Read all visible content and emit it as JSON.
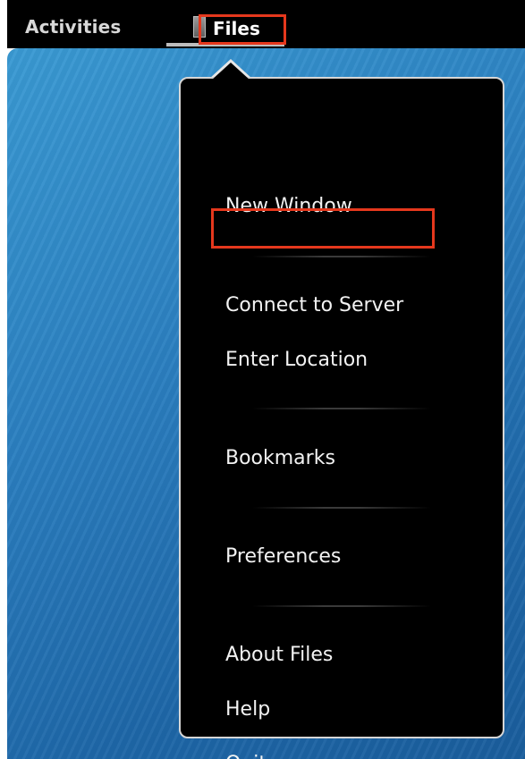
{
  "topbar": {
    "activities_label": "Activities",
    "app_label": "Files"
  },
  "menu": {
    "items": [
      {
        "label": "New Window"
      },
      {
        "label": "Connect to Server"
      },
      {
        "label": "Enter Location"
      },
      {
        "label": "Bookmarks"
      },
      {
        "label": "Preferences"
      },
      {
        "label": "About Files"
      },
      {
        "label": "Help"
      },
      {
        "label": "Quit"
      }
    ]
  },
  "colors": {
    "highlight": "#e5381d",
    "menu_background": "#000000",
    "desktop_blue": "#2b7fc0"
  },
  "icons": {
    "app_icon": "files-app-icon"
  }
}
